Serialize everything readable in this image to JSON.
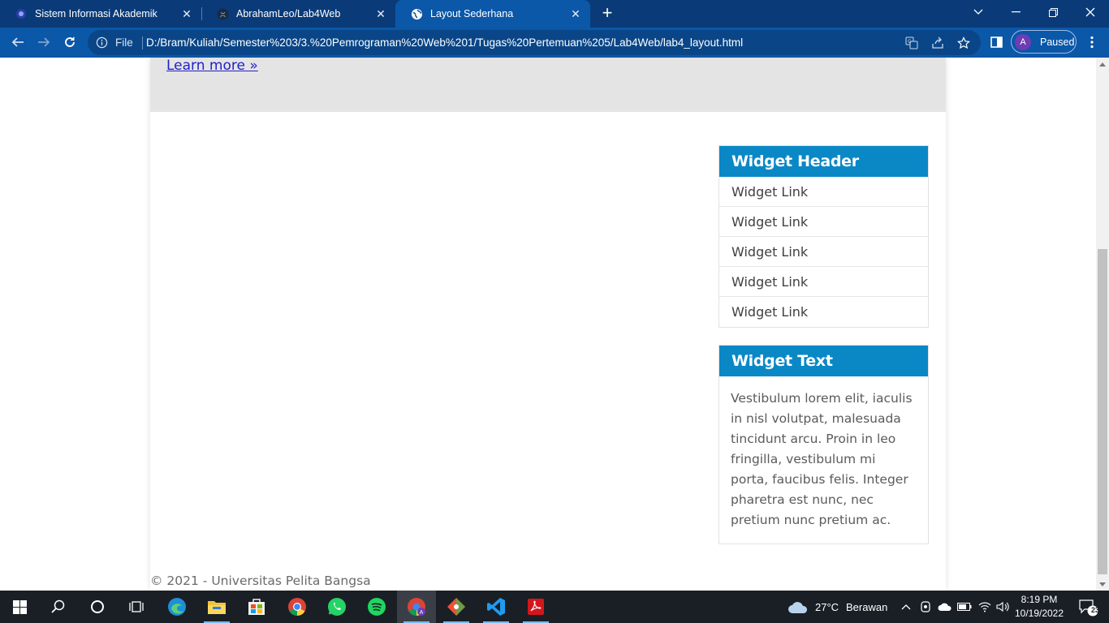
{
  "browser": {
    "tabs": [
      {
        "title": "Sistem Informasi Akademik",
        "active": false
      },
      {
        "title": "AbrahamLeo/Lab4Web",
        "active": false
      },
      {
        "title": "Layout Sederhana",
        "active": true
      }
    ],
    "address": {
      "scheme_label": "File",
      "url": "D:/Bram/Kuliah/Semester%203/3.%20Pemrograman%20Web%201/Tugas%20Pertemuan%205/Lab4Web/lab4_layout.html"
    },
    "profile": {
      "initial": "A",
      "status": "Paused"
    }
  },
  "page": {
    "hero_link": "Learn more »",
    "widgets": [
      {
        "header": "Widget Header",
        "links": [
          "Widget Link",
          "Widget Link",
          "Widget Link",
          "Widget Link",
          "Widget Link"
        ]
      },
      {
        "header": "Widget Text",
        "text": "Vestibulum lorem elit, iaculis in nisl volutpat, malesuada tincidunt arcu. Proin in leo fringilla, vestibulum mi porta, faucibus felis. Integer pharetra est nunc, nec pretium nunc pretium ac."
      }
    ],
    "footer": "© 2021 - Universitas Pelita Bangsa"
  },
  "taskbar": {
    "weather": {
      "temp": "27°C",
      "condition": "Berawan"
    },
    "clock": {
      "time": "8:19 PM",
      "date": "10/19/2022"
    },
    "notifications": "23"
  },
  "colors": {
    "tabbar": "#0a3b78",
    "toolbar": "#0b57a8",
    "widget_header": "#0a88c6",
    "hero_bg": "#e4e4e4",
    "taskbar": "#1a1f26"
  }
}
